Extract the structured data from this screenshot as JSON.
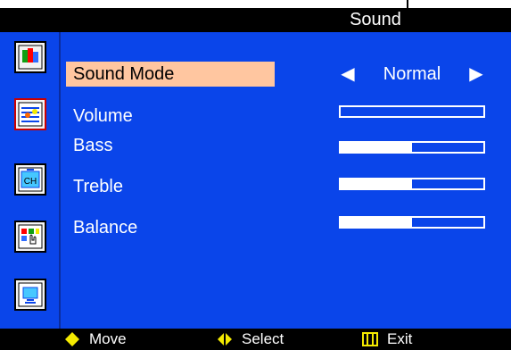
{
  "title": "Sound",
  "menu": {
    "items": [
      {
        "label": "Sound Mode",
        "selected": true
      },
      {
        "label": "Volume",
        "selected": false
      },
      {
        "label": "Bass",
        "selected": false
      },
      {
        "label": "Treble",
        "selected": false
      },
      {
        "label": "Balance",
        "selected": false
      }
    ]
  },
  "values": {
    "sound_mode": "Normal",
    "volume_level": 0,
    "bass_level": 0.5,
    "treble_level": 0.5,
    "balance_level": 0.5
  },
  "sidebar": {
    "icons": [
      "picture-icon",
      "sound-icon",
      "channel-icon",
      "feature-icon",
      "screen-icon"
    ]
  },
  "footer": {
    "move_label": "Move",
    "select_label": "Select",
    "exit_label": "Exit"
  },
  "colors": {
    "panel": "#0a45ea",
    "highlight": "#ffc6a0",
    "footer": "#000000",
    "text": "#ffffff",
    "icon_yellow": "#f4ea00"
  }
}
